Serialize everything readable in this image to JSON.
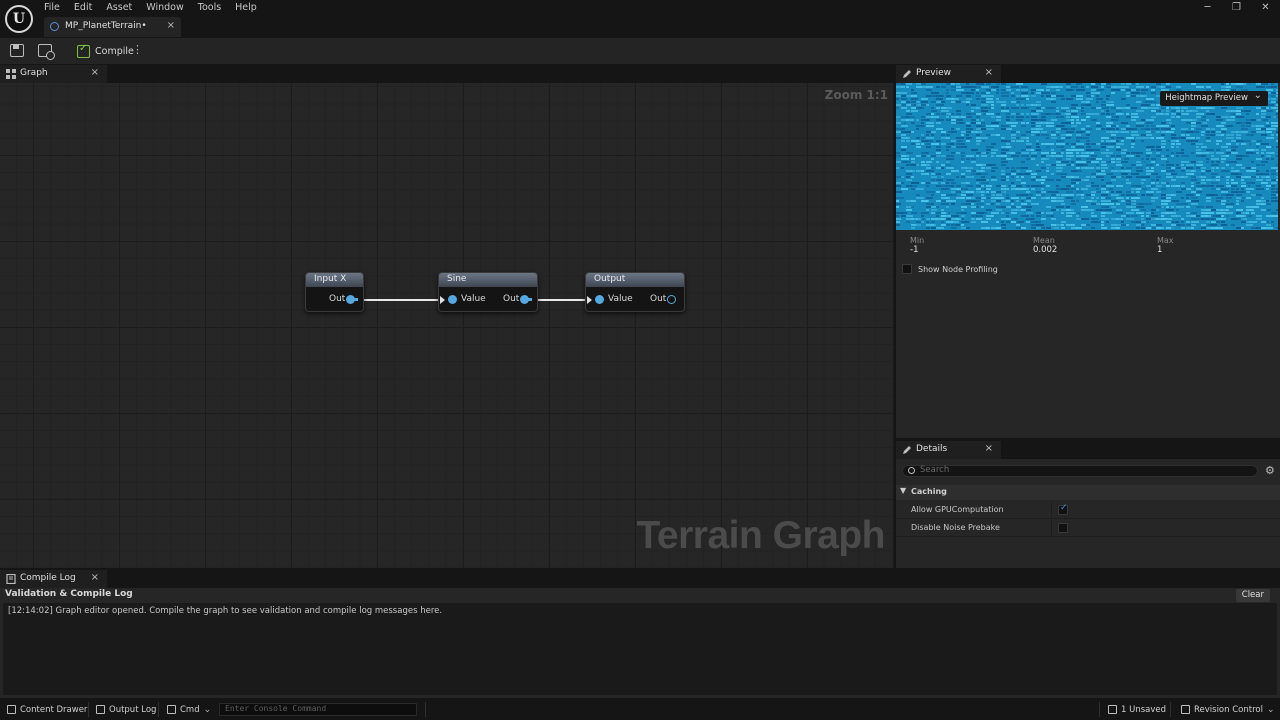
{
  "menu": [
    "File",
    "Edit",
    "Asset",
    "Window",
    "Tools",
    "Help"
  ],
  "window_controls": {
    "minimize": "─",
    "restore": "❐",
    "close": "✕"
  },
  "document_tab": {
    "label": "MP_PlanetTerrain•",
    "close": "×"
  },
  "toolbar": {
    "compile_label": "Compile",
    "more": "⋮"
  },
  "graph_panel": {
    "tab_label": "Graph",
    "close": "×",
    "zoom_label": "Zoom 1:1",
    "watermark": "Terrain Graph",
    "nodes": [
      {
        "title": "Input X",
        "out_label": "Out"
      },
      {
        "title": "Sine",
        "in_label": "Value",
        "out_label": "Out"
      },
      {
        "title": "Output",
        "in_label": "Value",
        "out_label": "Out"
      }
    ]
  },
  "preview_panel": {
    "tab_label": "Preview",
    "close": "×",
    "dropdown_label": "Heightmap Preview",
    "stats": [
      {
        "label": "Min",
        "value": "-1"
      },
      {
        "label": "Mean",
        "value": "0.002"
      },
      {
        "label": "Max",
        "value": "1"
      }
    ],
    "show_profiling_label": "Show Node Profiling",
    "show_profiling_checked": false,
    "colors": {
      "base": "#1689bd",
      "light": "#4cc3e8",
      "dark": "#0d5f94"
    }
  },
  "details_panel": {
    "tab_label": "Details",
    "close": "×",
    "search_placeholder": "Search",
    "section_label": "Caching",
    "properties": [
      {
        "label": "Allow GPUComputation",
        "checked": true
      },
      {
        "label": "Disable Noise Prebake",
        "checked": false
      }
    ]
  },
  "compile_log": {
    "tab_label": "Compile Log",
    "close": "×",
    "title": "Validation & Compile Log",
    "clear_label": "Clear",
    "message": "[12:14:02] Graph editor opened. Compile the graph to see validation and compile log messages here."
  },
  "status_bar": {
    "content_drawer": "Content Drawer",
    "output_log": "Output Log",
    "cmd": "Cmd",
    "console_placeholder": "Enter Console Command",
    "unsaved": "1 Unsaved",
    "revision_control": "Revision Control"
  }
}
